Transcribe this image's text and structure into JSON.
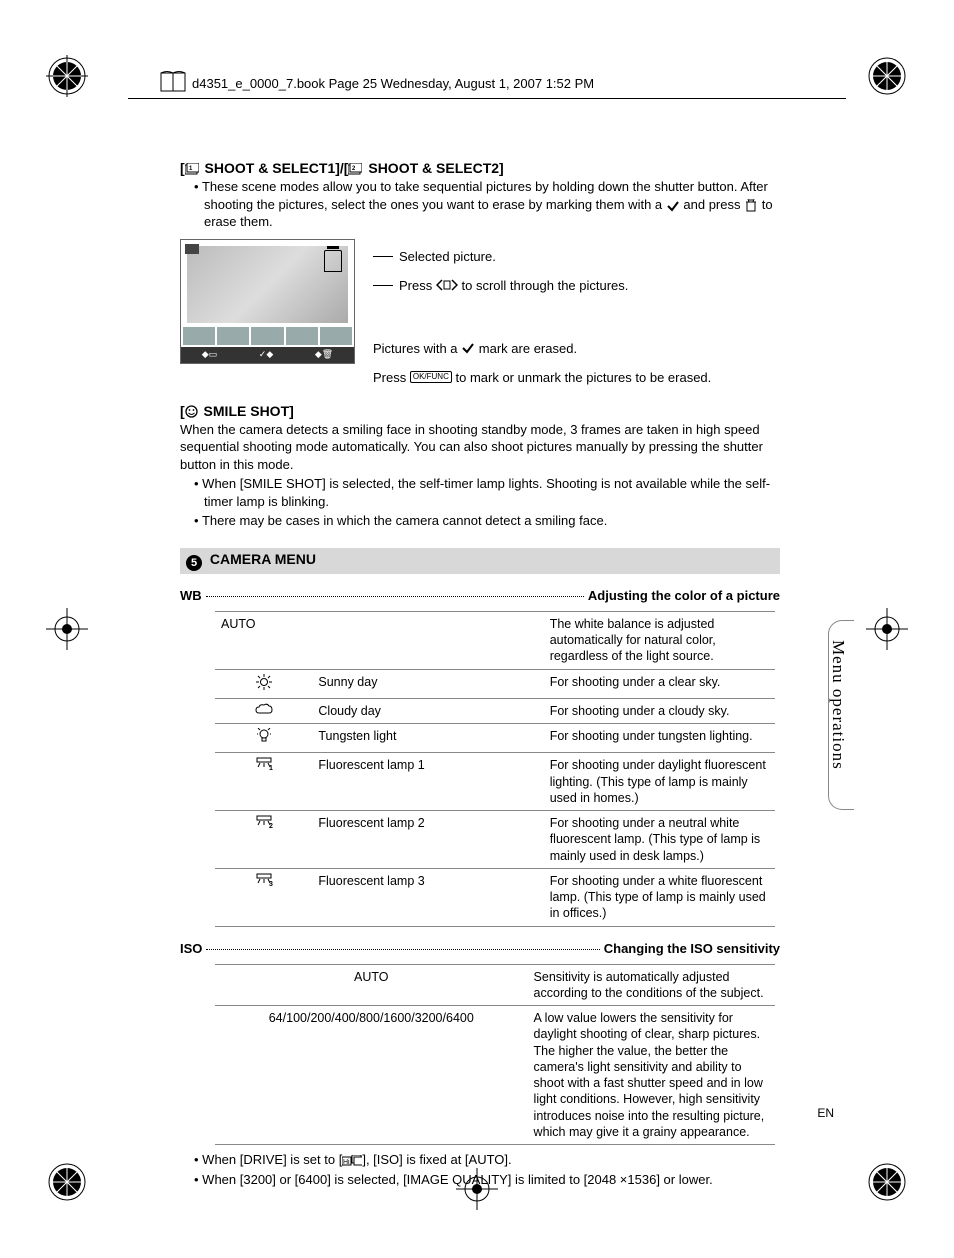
{
  "header": {
    "line": "d4351_e_0000_7.book  Page 25  Wednesday, August 1, 2007  1:52 PM"
  },
  "shoot_select": {
    "title": "[e SHOOT & SELECT1]/[f SHOOT & SELECT2]",
    "desc": "These scene modes allow you to take sequential pictures by holding down the shutter button. After shooting the pictures, select the ones you want to erase by marking them with a",
    "desc2": "and press",
    "desc3": "to erase them.",
    "annot1": "Selected picture.",
    "annot2_a": "Press",
    "annot2_b": "to scroll through the pictures.",
    "annot3_a": "Pictures with a",
    "annot3_b": "mark are erased.",
    "annot4_a": "Press",
    "annot4_b": "to mark or unmark the pictures to be erased."
  },
  "smile": {
    "title": "[N SMILE SHOT]",
    "desc": "When the camera detects a smiling face in shooting standby mode, 3 frames are taken in high speed sequential shooting mode automatically. You can also shoot pictures manually by pressing the shutter button in this mode.",
    "bullet1": "When [SMILE SHOT] is selected, the self-timer lamp lights. Shooting is not available while the self-timer lamp is blinking.",
    "bullet2": "There may be cases in which the camera cannot detect a smiling face."
  },
  "camera_menu": {
    "num": "5",
    "label": "CAMERA MENU"
  },
  "wb": {
    "key": "WB",
    "desc": "Adjusting the color of a picture",
    "rows": [
      {
        "icon": "",
        "name": "AUTO",
        "text": "The white balance is adjusted automatically for natural color, regardless of the light source."
      },
      {
        "icon": "sun",
        "name": "Sunny day",
        "text": "For shooting under a clear sky."
      },
      {
        "icon": "cloud",
        "name": "Cloudy day",
        "text": "For shooting under a cloudy sky."
      },
      {
        "icon": "bulb",
        "name": "Tungsten light",
        "text": "For shooting under tungsten lighting."
      },
      {
        "icon": "fl1",
        "name": "Fluorescent lamp 1",
        "text": "For shooting under daylight fluorescent lighting. (This type of lamp is mainly used in homes.)"
      },
      {
        "icon": "fl2",
        "name": "Fluorescent lamp 2",
        "text": "For shooting under a neutral white fluorescent lamp. (This type of lamp is mainly used in desk lamps.)"
      },
      {
        "icon": "fl3",
        "name": "Fluorescent lamp 3",
        "text": "For shooting under a white fluorescent lamp. (This type of lamp is mainly used in offices.)"
      }
    ]
  },
  "iso": {
    "key": "ISO",
    "desc": "Changing the ISO sensitivity",
    "rows": [
      {
        "name": "AUTO",
        "text": "Sensitivity is automatically adjusted according to the conditions of the subject."
      },
      {
        "name": "64/100/200/400/800/1600/3200/6400",
        "text": "A low value lowers the sensitivity for daylight shooting of clear, sharp pictures. The higher the value, the better the camera's light sensitivity and ability to shoot with a fast shutter speed and in low light conditions. However, high sensitivity introduces noise into the resulting picture, which may give it a grainy appearance."
      }
    ],
    "note1_a": "When [DRIVE] is set to [",
    "note1_b": "], [ISO] is fixed at [AUTO].",
    "note2": "When [3200] or [6400] is selected, [IMAGE QUALITY] is limited to [2048 ×1536] or lower."
  },
  "side": {
    "label": "Menu operations"
  },
  "footer": {
    "en": "EN"
  },
  "okfunc": "OK/FUNC"
}
